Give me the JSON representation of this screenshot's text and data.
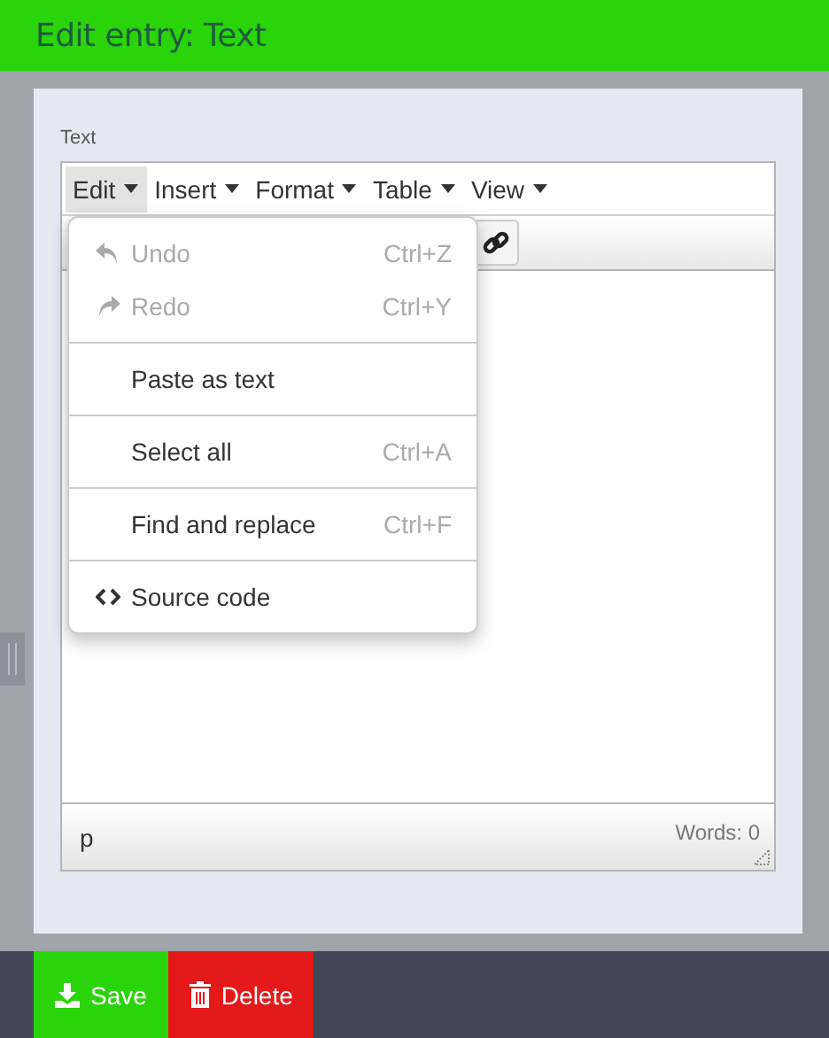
{
  "header": {
    "title": "Edit entry: Text"
  },
  "field": {
    "label": "Text"
  },
  "menubar": [
    {
      "label": "Edit",
      "selected": true
    },
    {
      "label": "Insert",
      "selected": false
    },
    {
      "label": "Format",
      "selected": false
    },
    {
      "label": "Table",
      "selected": false
    },
    {
      "label": "View",
      "selected": false
    }
  ],
  "dropdown": {
    "groups": [
      [
        {
          "kind": "undo",
          "label": "Undo",
          "shortcut": "Ctrl+Z",
          "disabled": true
        },
        {
          "kind": "redo",
          "label": "Redo",
          "shortcut": "Ctrl+Y",
          "disabled": true
        }
      ],
      [
        {
          "kind": "plain",
          "label": "Paste as text",
          "disabled": false
        }
      ],
      [
        {
          "kind": "plain",
          "label": "Select all",
          "shortcut": "Ctrl+A",
          "disabled": false
        }
      ],
      [
        {
          "kind": "plain",
          "label": "Find and replace",
          "shortcut": "Ctrl+F",
          "disabled": false
        }
      ],
      [
        {
          "kind": "code",
          "label": "Source code",
          "disabled": false
        }
      ]
    ]
  },
  "statusbar": {
    "path": "p",
    "words": "Words: 0"
  },
  "buttons": [
    {
      "kind": "save",
      "label": "Save"
    },
    {
      "kind": "delete",
      "label": "Delete"
    }
  ]
}
